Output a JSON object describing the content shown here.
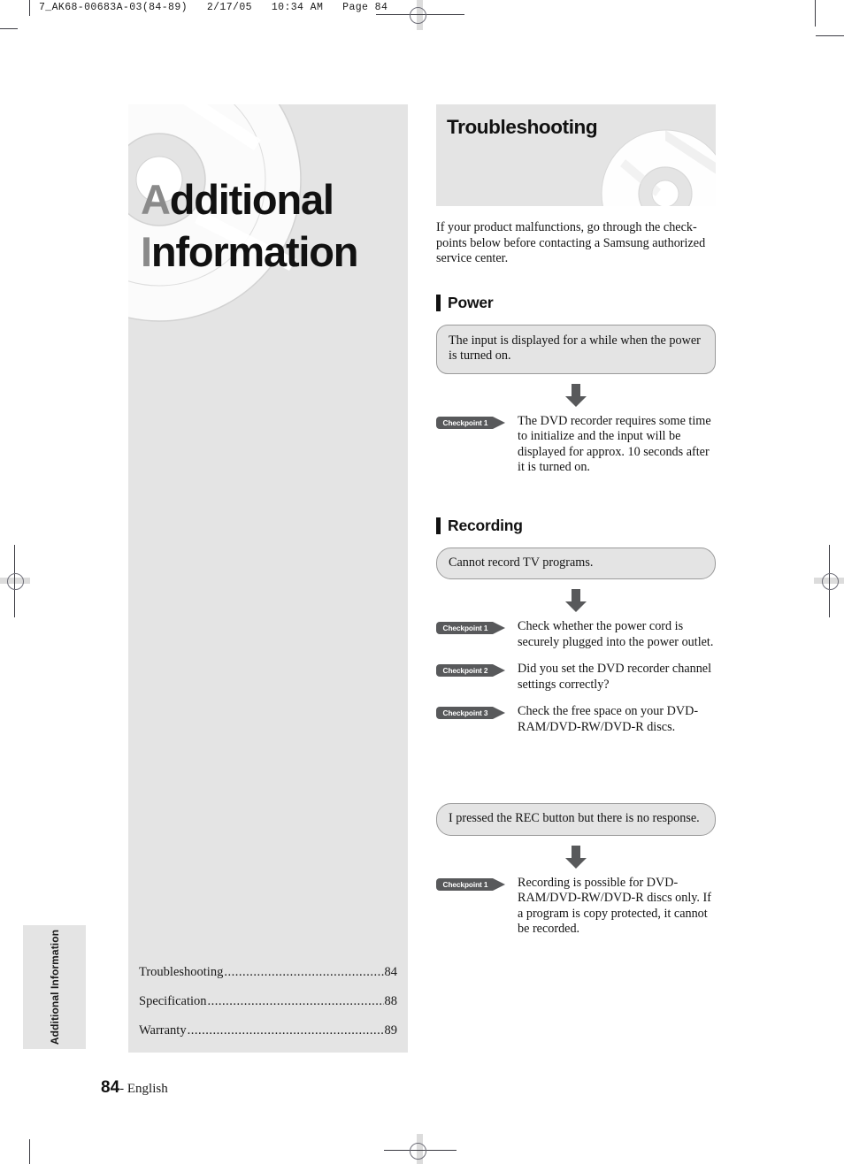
{
  "prepress": {
    "file_info": "7_AK68-00683A-03(84-89)   2/17/05   10:34 AM   Page 84"
  },
  "chapter": {
    "title_line1_initial": "A",
    "title_line1_rest": "dditional",
    "title_line2_initial": "I",
    "title_line2_rest": "nformation",
    "watermark_icon": "dvd-disc-icon",
    "side_tab_label": "Additional Information",
    "toc": [
      {
        "label": "Troubleshooting",
        "dots": "..............................................................................",
        "page": "84"
      },
      {
        "label": "Specification",
        "dots": "..............................................................................",
        "page": "88"
      },
      {
        "label": "Warranty ",
        "dots": "..............................................................................",
        "page": "89"
      }
    ]
  },
  "footer": {
    "page_number": "84",
    "language": "- English"
  },
  "content": {
    "banner_title": "Troubleshooting",
    "banner_icon": "dvd-disc-icon",
    "intro": "If your product malfunctions, go through the check-points below before contacting a Samsung authorized service center.",
    "sections": [
      {
        "heading": "Power",
        "blocks": [
          {
            "question": "The input is displayed for a while when the power is turned on.",
            "arrow_icon": "arrow-down-icon",
            "checkpoints": [
              {
                "badge": "Checkpoint 1",
                "text": "The DVD recorder requires some time to initialize and the input will be displayed for approx. 10 seconds after it is turned on."
              }
            ]
          }
        ]
      },
      {
        "heading": "Recording",
        "blocks": [
          {
            "question": "Cannot record TV programs.",
            "arrow_icon": "arrow-down-icon",
            "checkpoints": [
              {
                "badge": "Checkpoint 1",
                "text": "Check whether the power cord is securely plugged into the power outlet."
              },
              {
                "badge": "Checkpoint 2",
                "text": "Did you set the DVD recorder channel settings correctly?"
              },
              {
                "badge": "Checkpoint 3",
                "text": "Check the free space on your DVD-RAM/DVD-RW/DVD-R discs."
              }
            ]
          },
          {
            "question": "I pressed the REC button but there is no response.",
            "arrow_icon": "arrow-down-icon",
            "checkpoints": [
              {
                "badge": "Checkpoint 1",
                "text": "Recording is possible for DVD-RAM/DVD-RW/DVD-R discs only. If a program is copy protected, it cannot be recorded."
              }
            ]
          }
        ]
      }
    ]
  },
  "colors": {
    "panel_gray": "#e4e4e4",
    "badge_gray": "#58595b",
    "text_black": "#141414",
    "dropcap_gray": "#8a8a8a"
  }
}
